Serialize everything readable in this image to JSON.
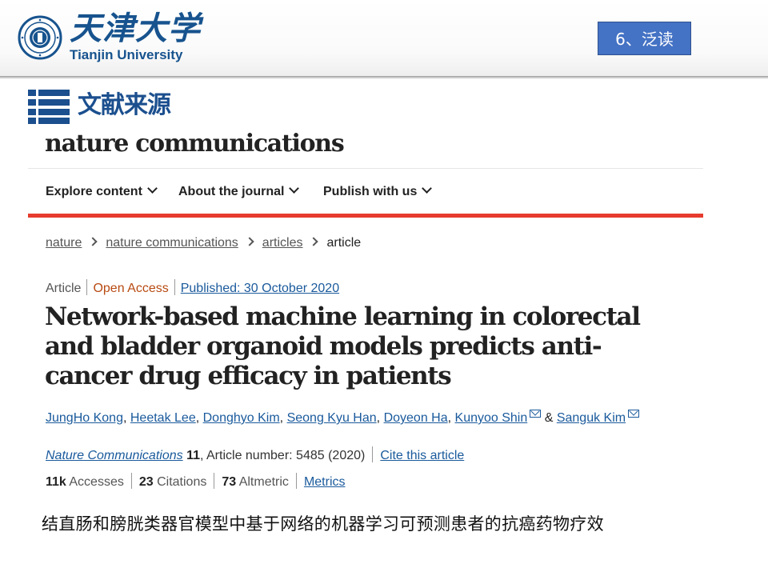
{
  "header": {
    "university_cn": "天津大学",
    "university_en": "Tianjin University",
    "slide_tag": "6、泛读",
    "brand_color": "#17538e",
    "tag_color": "#4472c4"
  },
  "section": {
    "title": "文献来源",
    "icon": "list-icon"
  },
  "journal": {
    "name": "nature communications",
    "nav": [
      {
        "label": "Explore content"
      },
      {
        "label": "About the journal"
      },
      {
        "label": "Publish with us"
      }
    ],
    "accent_color": "#e63b2e"
  },
  "breadcrumb": [
    "nature",
    "nature communications",
    "articles",
    "article"
  ],
  "article": {
    "type": "Article",
    "access": "Open Access",
    "published": "Published: 30 October 2020",
    "title": "Network-based machine learning in colorectal and bladder organoid models predicts anti-cancer drug efficacy in patients",
    "authors": [
      "JungHo Kong",
      "Heetak Lee",
      "Donghyo Kim",
      "Seong Kyu Han",
      "Doyeon Ha",
      "Kunyoo Shin",
      "Sanguk Kim"
    ],
    "author_sep": ",",
    "author_amp": "&",
    "journal_ref": "Nature Communications",
    "volume": "11",
    "article_number": ", Article number: 5485 (2020)",
    "cite_link": "Cite this article",
    "metrics": [
      {
        "value": "11k",
        "label": "Accesses"
      },
      {
        "value": "23",
        "label": "Citations"
      },
      {
        "value": "73",
        "label": "Altmetric"
      }
    ],
    "metrics_link": "Metrics"
  },
  "caption": "结直肠和膀胱类器官模型中基于网络的机器学习可预测患者的抗癌药物疗效"
}
